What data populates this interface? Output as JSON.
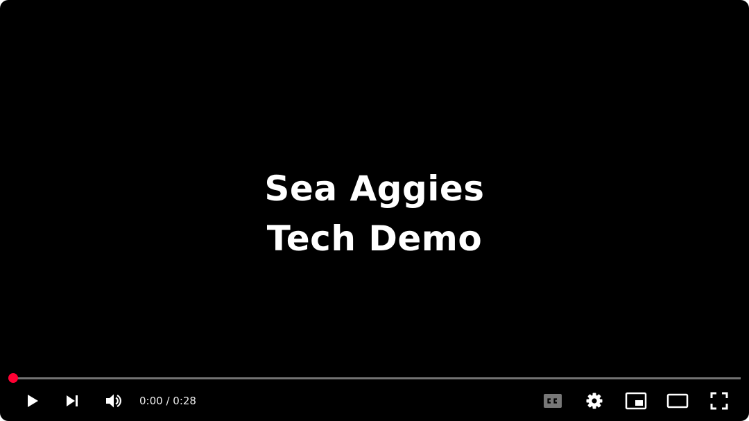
{
  "video": {
    "title_line1": "Sea Aggies",
    "title_line2": "Tech Demo"
  },
  "progress": {
    "played_fraction": 0.0,
    "played_color": "#ff0033"
  },
  "time": {
    "current": "0:00",
    "separator": " / ",
    "duration": "0:28"
  },
  "controls": {
    "left": [
      "play-icon",
      "next-icon",
      "volume-icon"
    ],
    "right": [
      "subtitles-icon",
      "settings-icon",
      "miniplayer-icon",
      "theater-mode-icon",
      "fullscreen-icon"
    ]
  }
}
